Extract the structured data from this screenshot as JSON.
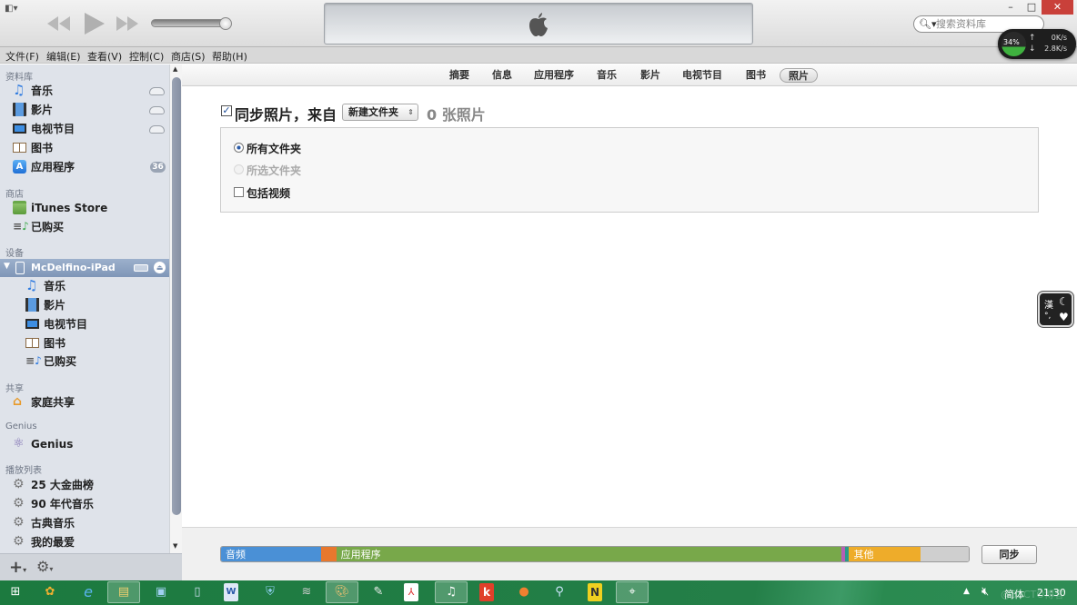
{
  "window": {
    "search_placeholder": "搜索资料库",
    "minimize": "–",
    "maximize": "□",
    "close": "✕"
  },
  "menu": [
    "文件(F)",
    "编辑(E)",
    "查看(V)",
    "控制(C)",
    "商店(S)",
    "帮助(H)"
  ],
  "netmon": {
    "percent": "34%",
    "up": "0K/s",
    "down": "2.8K/s",
    "fill_percent": 34
  },
  "sidebar": {
    "library_head": "资料库",
    "library": [
      {
        "label": "音乐",
        "icon": "music-note-icon",
        "cloud": true
      },
      {
        "label": "影片",
        "icon": "film-icon",
        "cloud": true
      },
      {
        "label": "电视节目",
        "icon": "tv-icon",
        "cloud": true
      },
      {
        "label": "图书",
        "icon": "book-icon",
        "cloud": false
      },
      {
        "label": "应用程序",
        "icon": "app-store-icon",
        "badge": "36"
      }
    ],
    "store_head": "商店",
    "store": [
      {
        "label": "iTunes Store",
        "icon": "itunes-store-bag-icon"
      },
      {
        "label": "已购买",
        "icon": "purchased-icon"
      }
    ],
    "devices_head": "设备",
    "device": {
      "name": "McDelfino-iPad"
    },
    "device_items": [
      {
        "label": "音乐",
        "icon": "music-note-icon"
      },
      {
        "label": "影片",
        "icon": "film-icon"
      },
      {
        "label": "电视节目",
        "icon": "tv-icon"
      },
      {
        "label": "图书",
        "icon": "book-icon"
      },
      {
        "label": "已购买",
        "icon": "purchased-icon"
      }
    ],
    "shared_head": "共享",
    "shared": [
      {
        "label": "家庭共享",
        "icon": "home-sharing-icon"
      }
    ],
    "genius_head": "Genius",
    "genius": [
      {
        "label": "Genius",
        "icon": "genius-atom-icon"
      }
    ],
    "playlists_head": "播放列表",
    "playlists": [
      {
        "label": "25 大金曲榜"
      },
      {
        "label": "90 年代音乐"
      },
      {
        "label": "古典音乐"
      },
      {
        "label": "我的最爱"
      }
    ]
  },
  "tabs": [
    {
      "label": "摘要"
    },
    {
      "label": "信息"
    },
    {
      "label": "应用程序"
    },
    {
      "label": "音乐"
    },
    {
      "label": "影片"
    },
    {
      "label": "电视节目"
    },
    {
      "label": "图书"
    },
    {
      "label": "照片",
      "active": true
    }
  ],
  "photos": {
    "sync_label": "同步照片，来自",
    "sync_checked": true,
    "source_select": "新建文件夹",
    "count": "0 张照片",
    "options": [
      {
        "label": "所有文件夹",
        "type": "radio",
        "checked": true,
        "disabled": false
      },
      {
        "label": "所选文件夹",
        "type": "radio",
        "checked": false,
        "disabled": true
      },
      {
        "label": "包括视频",
        "type": "checkbox",
        "checked": false,
        "disabled": false
      }
    ]
  },
  "capacity": {
    "segments": [
      {
        "label": "音频",
        "color": "#4a90d6",
        "percent": 13.4
      },
      {
        "label": "",
        "color": "#e8782e",
        "percent": 2.0
      },
      {
        "label": "应用程序",
        "color": "#78a84a",
        "percent": 67.6
      },
      {
        "label": "",
        "color": "#b55fb5",
        "percent": 0.4
      },
      {
        "label": "",
        "color": "#2a9a8a",
        "percent": 0.6
      },
      {
        "label": "其他",
        "color": "#eeac2a",
        "percent": 9.5
      },
      {
        "label": "",
        "color": "#cfcfcf",
        "percent": 6.5
      }
    ],
    "sync_button": "同步"
  },
  "ime": {
    "top_left": "漢",
    "bottom_left": "°,"
  },
  "taskbar": {
    "apps": [
      "windows-start",
      "photo-app",
      "internet-explorer",
      "file-explorer",
      "control-panel",
      "notepad",
      "word",
      "app-store-bag",
      "wifi-tool",
      "paint",
      "pen-tool",
      "pdf-reader",
      "itunes",
      "kingsoft",
      "firefox",
      "app-o",
      "notes-n",
      "cursor-tool"
    ],
    "lang": "简体",
    "time": "21:30",
    "watermark": "@51CTO博客"
  }
}
